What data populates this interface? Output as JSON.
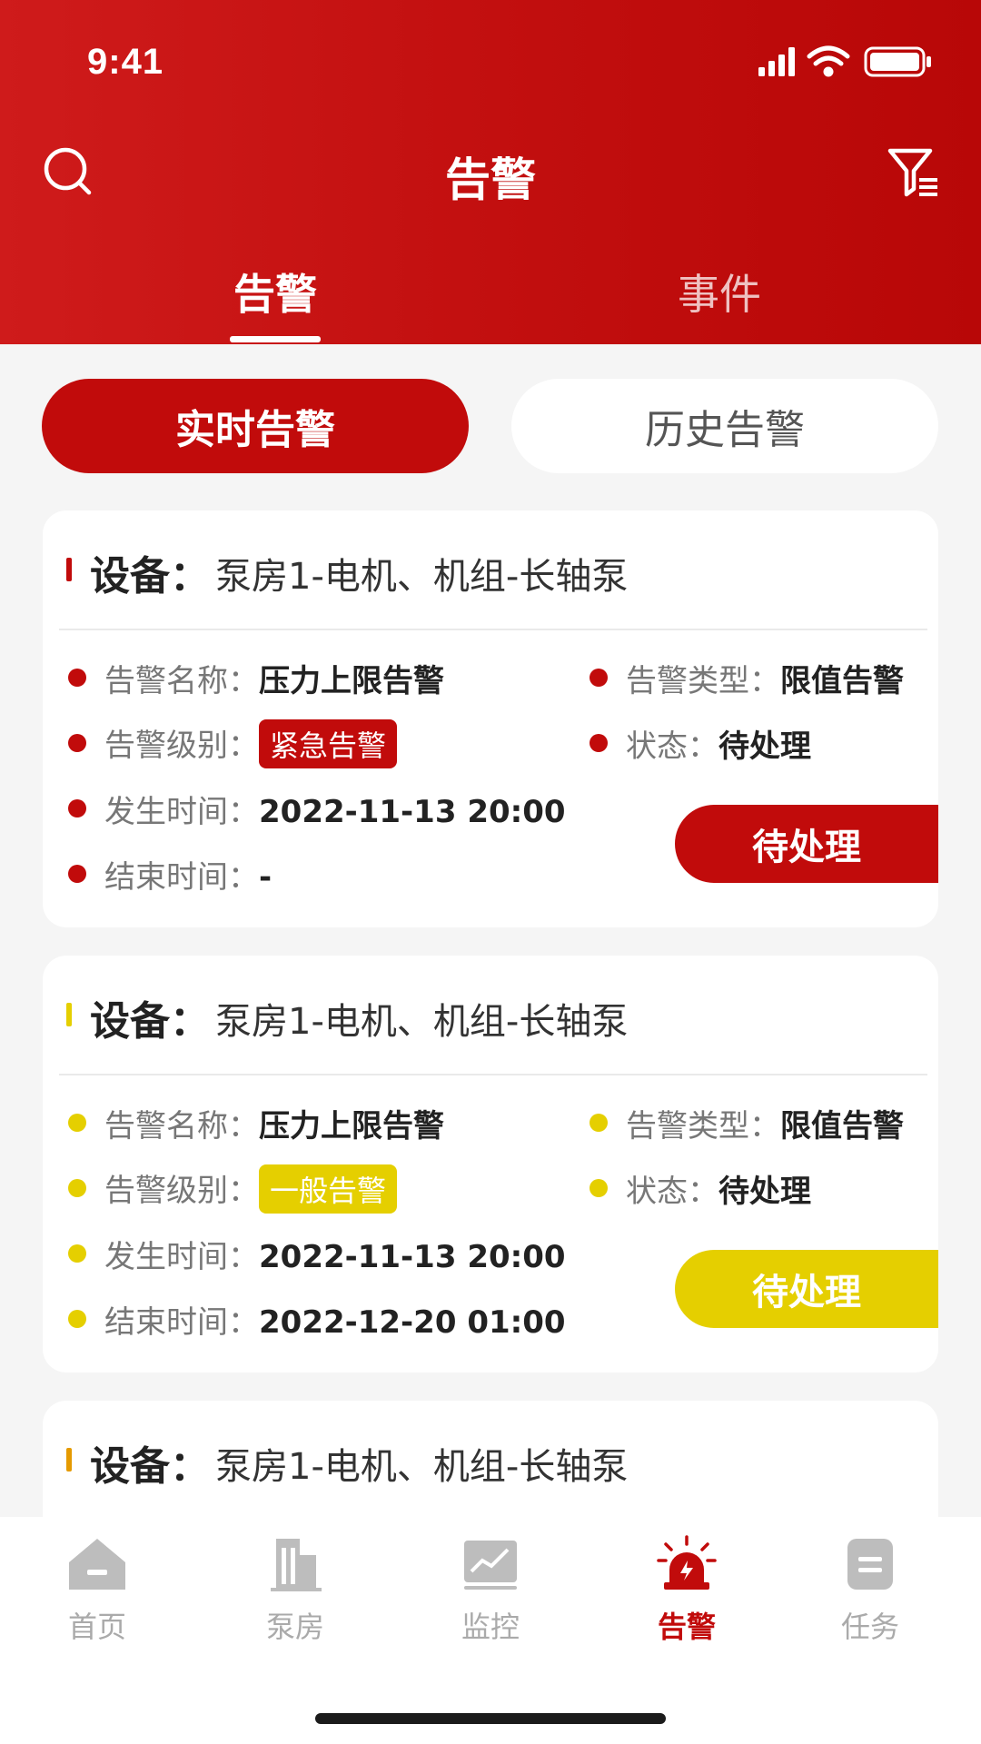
{
  "status_bar": {
    "time": "9:41"
  },
  "header": {
    "title": "告警",
    "search_icon": "search-icon",
    "filter_icon": "filter-icon"
  },
  "tabs": [
    {
      "label": "告警",
      "active": true
    },
    {
      "label": "事件",
      "active": false
    }
  ],
  "segment": {
    "realtime": "实时告警",
    "history": "历史告警"
  },
  "labels": {
    "device": "设备：",
    "alarm_name": "告警名称：",
    "alarm_type": "告警类型：",
    "alarm_level": "告警级别：",
    "status": "状态：",
    "start_time": "发生时间：",
    "end_time": "结束时间："
  },
  "cards": [
    {
      "device": "泵房1-电机、机组-长轴泵",
      "alarm_name": "压力上限告警",
      "alarm_type": "限值告警",
      "alarm_level": "紧急告警",
      "status": "待处理",
      "start_time": "2022-11-13  20:00",
      "end_time": "-",
      "action": "待处理",
      "color": "#c10b0b"
    },
    {
      "device": "泵房1-电机、机组-长轴泵",
      "alarm_name": "压力上限告警",
      "alarm_type": "限值告警",
      "alarm_level": "一般告警",
      "status": "待处理",
      "start_time": "2022-11-13  20:00",
      "end_time": "2022-12-20  01:00",
      "action": "待处理",
      "color": "#e5cf00"
    },
    {
      "device": "泵房1-电机、机组-长轴泵",
      "color": "#e59a00"
    }
  ],
  "bottom_nav": [
    {
      "label": "首页",
      "icon": "home-icon",
      "active": false
    },
    {
      "label": "泵房",
      "icon": "building-icon",
      "active": false
    },
    {
      "label": "监控",
      "icon": "monitor-chart-icon",
      "active": false
    },
    {
      "label": "告警",
      "icon": "alarm-siren-icon",
      "active": true
    },
    {
      "label": "任务",
      "icon": "task-icon",
      "active": false
    }
  ],
  "colors": {
    "brand": "#c10b0b",
    "warning_yellow": "#e5cf00",
    "warning_orange": "#e59a00"
  }
}
